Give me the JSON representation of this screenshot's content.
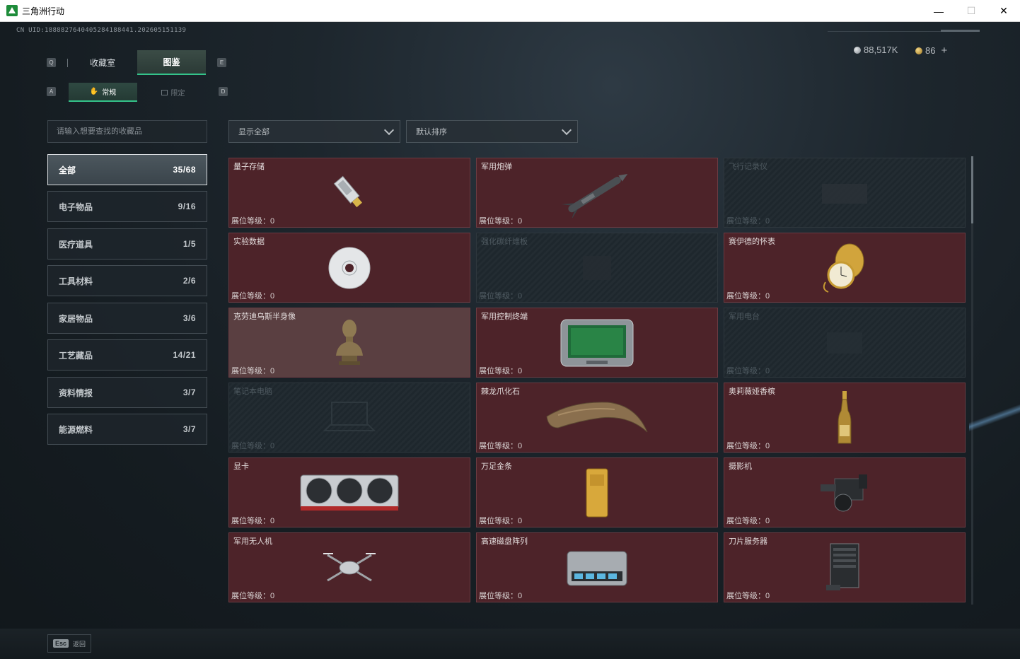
{
  "window": {
    "title": "三角洲行动",
    "minimize": "—",
    "maximize": "☐",
    "close": "✕"
  },
  "uid": "CN UID:1888827640405284188441.202605151139",
  "currency": {
    "silver": "88,517K",
    "gold": "86",
    "add": "+"
  },
  "keys": {
    "q": "Q",
    "e": "E",
    "a": "A",
    "d": "D"
  },
  "tabs": {
    "collection_room": "收藏室",
    "catalog": "图鉴"
  },
  "subtabs": {
    "normal": "常规",
    "limited": "限定"
  },
  "search": {
    "placeholder": "请输入想要查找的收藏品"
  },
  "filters": {
    "show_all": "显示全部",
    "sort": "默认排序"
  },
  "categories": [
    {
      "label": "全部",
      "count": "35/68",
      "active": true
    },
    {
      "label": "电子物品",
      "count": "9/16"
    },
    {
      "label": "医疗道具",
      "count": "1/5"
    },
    {
      "label": "工具材料",
      "count": "2/6"
    },
    {
      "label": "家居物品",
      "count": "3/6"
    },
    {
      "label": "工艺藏品",
      "count": "14/21"
    },
    {
      "label": "资料情报",
      "count": "3/7"
    },
    {
      "label": "能源燃料",
      "count": "3/7"
    }
  ],
  "level_label": "展位等级：",
  "cards": [
    {
      "name": "量子存储",
      "level": "0",
      "icon": "usb-drive-icon",
      "state": "owned"
    },
    {
      "name": "军用炮弹",
      "level": "0",
      "icon": "missile-icon",
      "state": "owned"
    },
    {
      "name": "飞行记录仪",
      "level": "0",
      "icon": "flight-recorder-icon",
      "state": "locked"
    },
    {
      "name": "实验数据",
      "level": "0",
      "icon": "disc-icon",
      "state": "owned"
    },
    {
      "name": "强化碳纤维板",
      "level": "0",
      "icon": "carbon-plate-icon",
      "state": "locked"
    },
    {
      "name": "赛伊德的怀表",
      "level": "0",
      "icon": "pocket-watch-icon",
      "state": "owned"
    },
    {
      "name": "克劳迪乌斯半身像",
      "level": "0",
      "icon": "bust-icon",
      "state": "owned"
    },
    {
      "name": "军用控制终端",
      "level": "0",
      "icon": "control-terminal-icon",
      "state": "owned"
    },
    {
      "name": "军用电台",
      "level": "0",
      "icon": "radio-icon",
      "state": "locked"
    },
    {
      "name": "笔记本电脑",
      "level": "0",
      "icon": "laptop-icon",
      "state": "locked"
    },
    {
      "name": "棘龙爪化石",
      "level": "0",
      "icon": "claw-fossil-icon",
      "state": "owned"
    },
    {
      "name": "奥莉薇娅香槟",
      "level": "0",
      "icon": "champagne-icon",
      "state": "owned"
    },
    {
      "name": "显卡",
      "level": "0",
      "icon": "gpu-icon",
      "state": "owned"
    },
    {
      "name": "万足金条",
      "level": "0",
      "icon": "gold-bar-icon",
      "state": "owned"
    },
    {
      "name": "摄影机",
      "level": "0",
      "icon": "camera-icon",
      "state": "owned"
    },
    {
      "name": "军用无人机",
      "level": "0",
      "icon": "drone-icon",
      "state": "owned"
    },
    {
      "name": "高速磁盘阵列",
      "level": "0",
      "icon": "disk-array-icon",
      "state": "owned"
    },
    {
      "name": "刀片服务器",
      "level": "0",
      "icon": "blade-server-icon",
      "state": "owned"
    }
  ],
  "footer": {
    "esc_key": "Esc",
    "back": "返回"
  }
}
